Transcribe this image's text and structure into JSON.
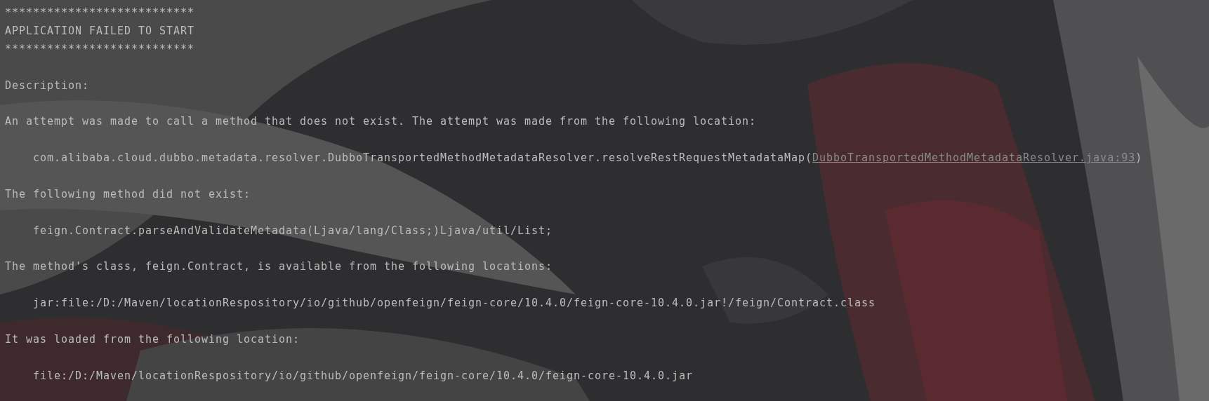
{
  "console": {
    "lines": [
      {
        "kind": "plain",
        "text": "***************************"
      },
      {
        "kind": "plain",
        "text": "APPLICATION FAILED TO START"
      },
      {
        "kind": "plain",
        "text": "***************************"
      },
      {
        "kind": "gap"
      },
      {
        "kind": "plain",
        "text": "Description:"
      },
      {
        "kind": "gap"
      },
      {
        "kind": "plain",
        "text": "An attempt was made to call a method that does not exist. The attempt was made from the following location:"
      },
      {
        "kind": "gap"
      },
      {
        "kind": "indented",
        "text": "com.alibaba.cloud.dubbo.metadata.resolver.DubboTransportedMethodMetadataResolver.resolveRestRequestMetadataMap(",
        "link": "DubboTransportedMethodMetadataResolver.java:93",
        "after": ")"
      },
      {
        "kind": "gap"
      },
      {
        "kind": "plain",
        "text": "The following method did not exist:"
      },
      {
        "kind": "gap"
      },
      {
        "kind": "indented",
        "text": "feign.Contract.parseAndValidateMetadata(Ljava/lang/Class;)Ljava/util/List;"
      },
      {
        "kind": "gap"
      },
      {
        "kind": "plain",
        "text": "The method's class, feign.Contract, is available from the following locations:"
      },
      {
        "kind": "gap"
      },
      {
        "kind": "indented",
        "text": "jar:file:/D:/Maven/locationRespository/io/github/openfeign/feign-core/10.4.0/feign-core-10.4.0.jar!/feign/Contract.class"
      },
      {
        "kind": "gap"
      },
      {
        "kind": "plain",
        "text": "It was loaded from the following location:"
      },
      {
        "kind": "gap"
      },
      {
        "kind": "indented",
        "text": "file:/D:/Maven/locationRespository/io/github/openfeign/feign-core/10.4.0/feign-core-10.4.0.jar"
      }
    ]
  }
}
